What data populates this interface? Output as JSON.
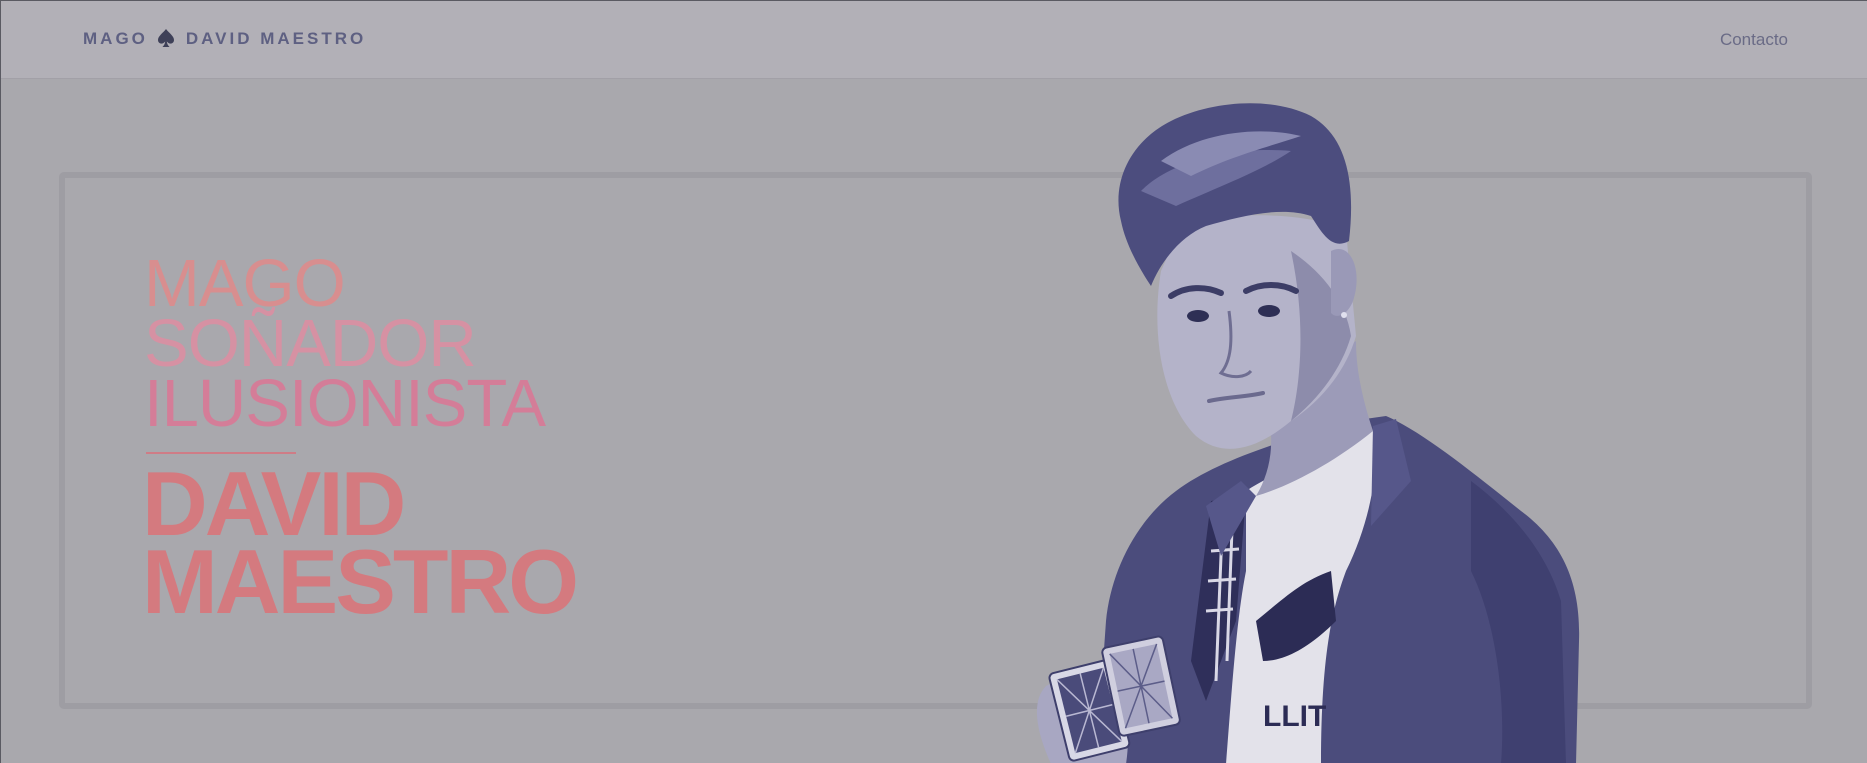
{
  "header": {
    "brand_left": "MAGO",
    "brand_right": "DAVID MAESTRO",
    "brand_icon": "spade-icon",
    "nav_contact": "Contacto"
  },
  "hero": {
    "tagline": [
      "MAGO",
      "SOÑADOR",
      "ILUSIONISTA"
    ],
    "name_line1": "DAVID",
    "name_line2": "MAESTRO"
  },
  "colors": {
    "background": "#a9a8ad",
    "header": "#b2b0b7",
    "brand_text": "#5e6082",
    "accent": "#d47a7f",
    "photo_tint": "#4e4f7e"
  }
}
